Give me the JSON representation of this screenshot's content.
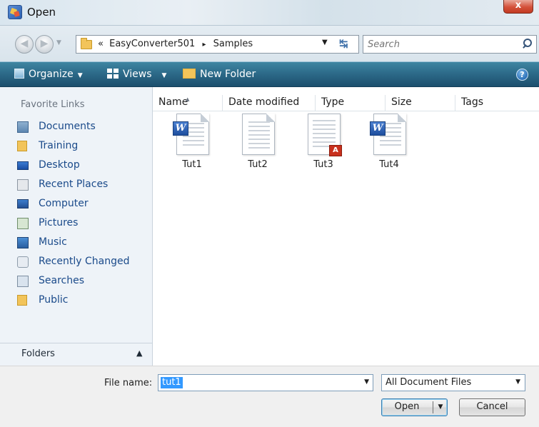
{
  "window": {
    "title": "Open",
    "close_glyph": "x"
  },
  "address": {
    "overflow_glyph": "«",
    "crumbs": [
      "EasyConverter501",
      "Samples"
    ],
    "separator": "▸",
    "search_placeholder": "Search"
  },
  "toolbar": {
    "organize_label": "Organize",
    "views_label": "Views",
    "new_folder_label": "New Folder",
    "help_glyph": "?"
  },
  "navigation": {
    "heading": "Favorite Links",
    "items": [
      {
        "label": "Documents",
        "icon": "documents-icon"
      },
      {
        "label": "Training",
        "icon": "folder-icon"
      },
      {
        "label": "Desktop",
        "icon": "desktop-icon"
      },
      {
        "label": "Recent Places",
        "icon": "recent-places-icon"
      },
      {
        "label": "Computer",
        "icon": "computer-icon"
      },
      {
        "label": "Pictures",
        "icon": "pictures-icon"
      },
      {
        "label": "Music",
        "icon": "music-icon"
      },
      {
        "label": "Recently Changed",
        "icon": "recently-changed-icon"
      },
      {
        "label": "Searches",
        "icon": "searches-icon"
      },
      {
        "label": "Public",
        "icon": "folder-icon"
      }
    ],
    "folders_label": "Folders"
  },
  "filelist": {
    "columns": [
      "Name",
      "Date modified",
      "Type",
      "Size",
      "Tags"
    ],
    "sorted_by": "Name",
    "files": [
      {
        "name": "Tut1",
        "kind": "word-document"
      },
      {
        "name": "Tut2",
        "kind": "plain-document"
      },
      {
        "name": "Tut3",
        "kind": "pdf-document"
      },
      {
        "name": "Tut4",
        "kind": "word-document"
      }
    ]
  },
  "bottom": {
    "file_name_label": "File name:",
    "file_name_value": "tut1",
    "file_type_value": "All Document Files",
    "open_label": "Open",
    "cancel_label": "Cancel"
  },
  "colors": {
    "toolbar": "#2d6b8a",
    "link": "#1a4a8a",
    "selection": "#3399ff",
    "close": "#d4513a"
  }
}
